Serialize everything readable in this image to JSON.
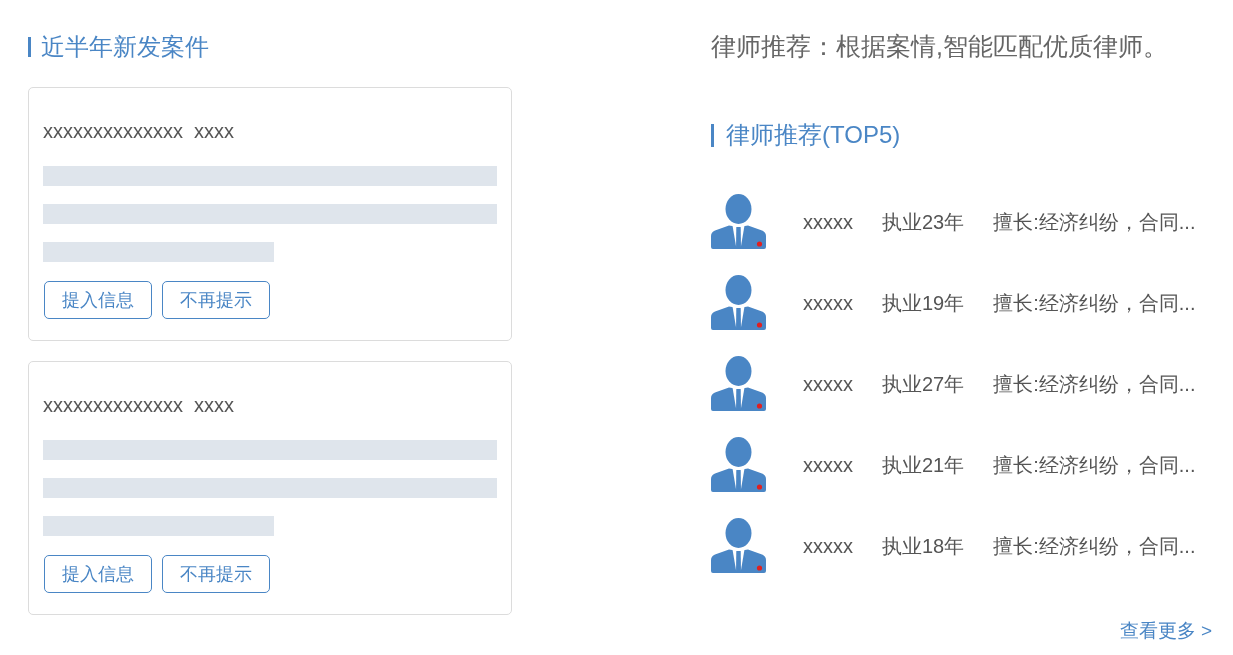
{
  "new_cases": {
    "title": "近半年新发案件",
    "cases": [
      {
        "title": "xxxxxxxxxxxxxx  xxxx",
        "buttons": [
          "提入信息",
          "不再提示"
        ]
      },
      {
        "title": "xxxxxxxxxxxxxx  xxxx",
        "buttons": [
          "提入信息",
          "不再提示"
        ]
      }
    ]
  },
  "recommendation": {
    "intro": "律师推荐：根据案情,智能匹配优质律师。",
    "title": "律师推荐(TOP5)",
    "lawyers": [
      {
        "name": "xxxxx",
        "experience": "执业23年",
        "specialty": "擅长:经济纠纷，合同..."
      },
      {
        "name": "xxxxx",
        "experience": "执业19年",
        "specialty": "擅长:经济纠纷，合同..."
      },
      {
        "name": "xxxxx",
        "experience": "执业27年",
        "specialty": "擅长:经济纠纷，合同..."
      },
      {
        "name": "xxxxx",
        "experience": "执业21年",
        "specialty": "擅长:经济纠纷，合同..."
      },
      {
        "name": "xxxxx",
        "experience": "执业18年",
        "specialty": "擅长:经济纠纷，合同..."
      }
    ],
    "more_link": "查看更多 >"
  }
}
